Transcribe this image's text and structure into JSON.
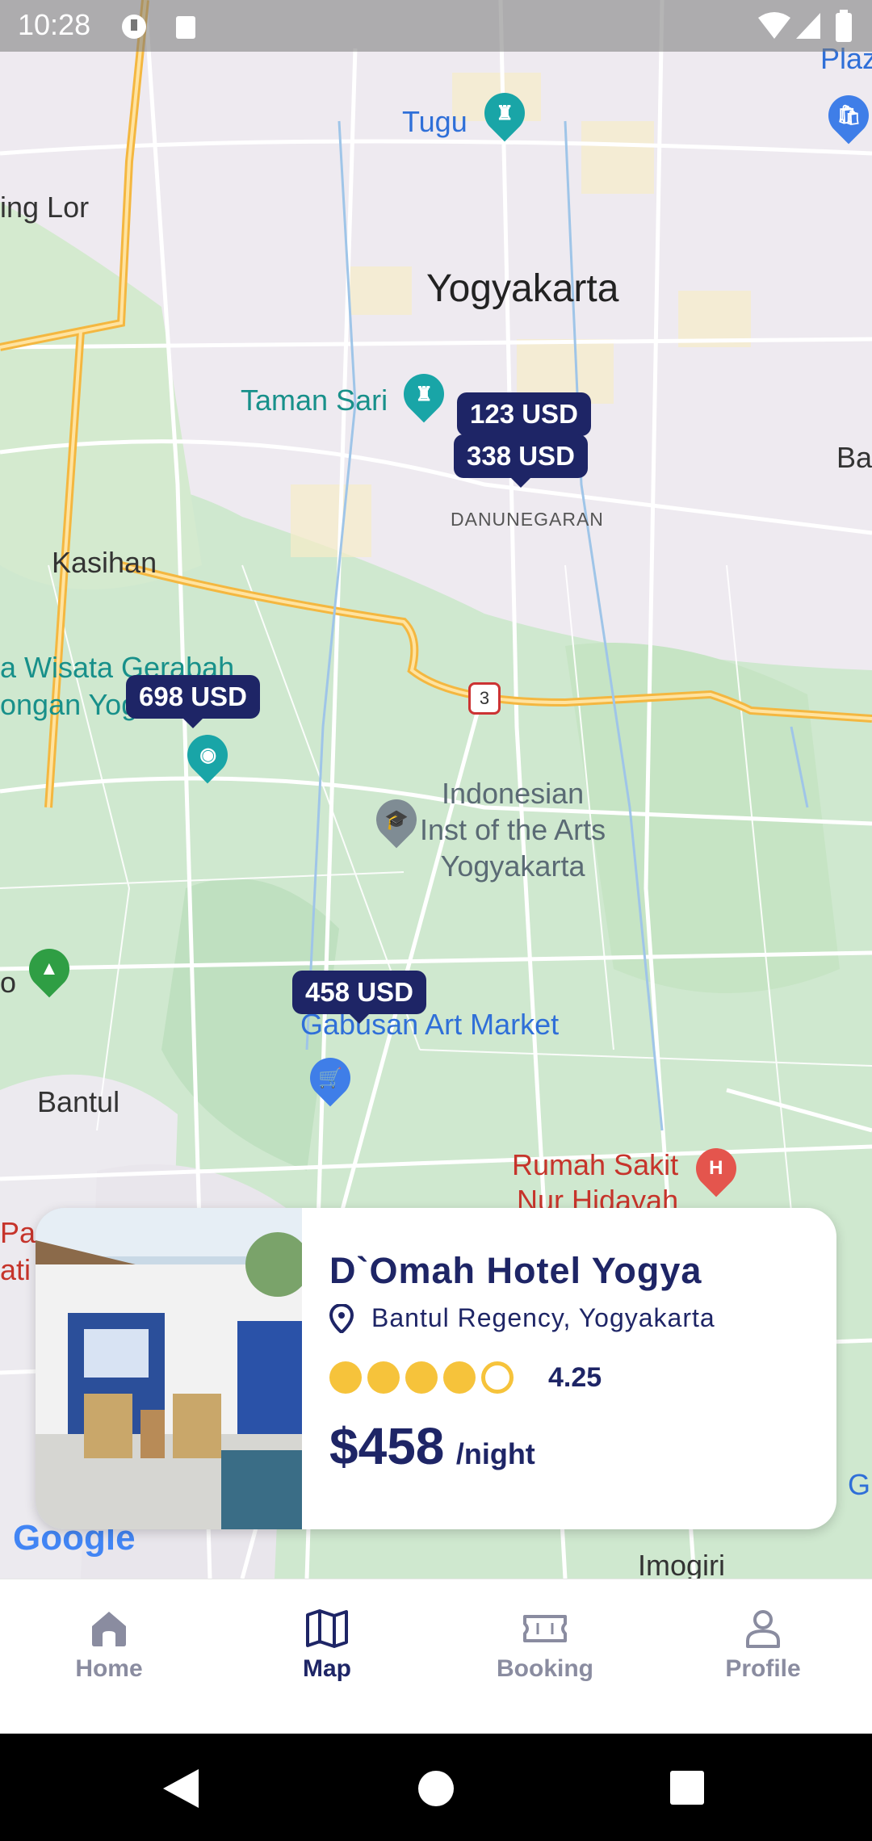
{
  "status_bar": {
    "time": "10:28"
  },
  "map": {
    "places": {
      "tugu": "Tugu",
      "plaza": "Plaz",
      "ring_lor": "ing Lor",
      "yogyakarta": "Yogyakarta",
      "taman_sari": "Taman Sari",
      "ba": "Ba",
      "danunegaran": "DANUNEGARAN",
      "kasihan": "Kasihan",
      "wisata_line1": "a Wisata Gerabah",
      "wisata_line2": "ongan Yog",
      "road_number": "3",
      "isi_line1": "Indonesian",
      "isi_line2": "Inst of the Arts",
      "isi_line3": "Yogyakarta",
      "gabusan": "Gabusan Art Market",
      "bantul": "Bantul",
      "rs_line1": "Rumah Sakit",
      "rs_line2": "Nur Hidayah",
      "par_line1": "Par",
      "par_line2": "ati",
      "g": "G",
      "imogiri": "Imogiri",
      "o": "o"
    },
    "price_markers": [
      "123 USD",
      "338 USD",
      "698 USD",
      "458 USD"
    ],
    "google_logo": "Google"
  },
  "hotel_card": {
    "name": "D`Omah Hotel Yogya",
    "location": "Bantul Regency, Yogyakarta",
    "rating": 4.25,
    "rating_text": "4.25",
    "stars_filled": 4,
    "stars_total": 5,
    "price": "$458",
    "price_unit": "/night"
  },
  "bottom_nav": {
    "items": [
      {
        "label": "Home",
        "icon": "home-icon"
      },
      {
        "label": "Map",
        "icon": "map-icon",
        "active": true
      },
      {
        "label": "Booking",
        "icon": "ticket-icon"
      },
      {
        "label": "Profile",
        "icon": "person-icon"
      }
    ]
  },
  "colors": {
    "primary": "#1e2566",
    "star": "#f6c33b",
    "inactive_nav": "#8a8ca0"
  }
}
